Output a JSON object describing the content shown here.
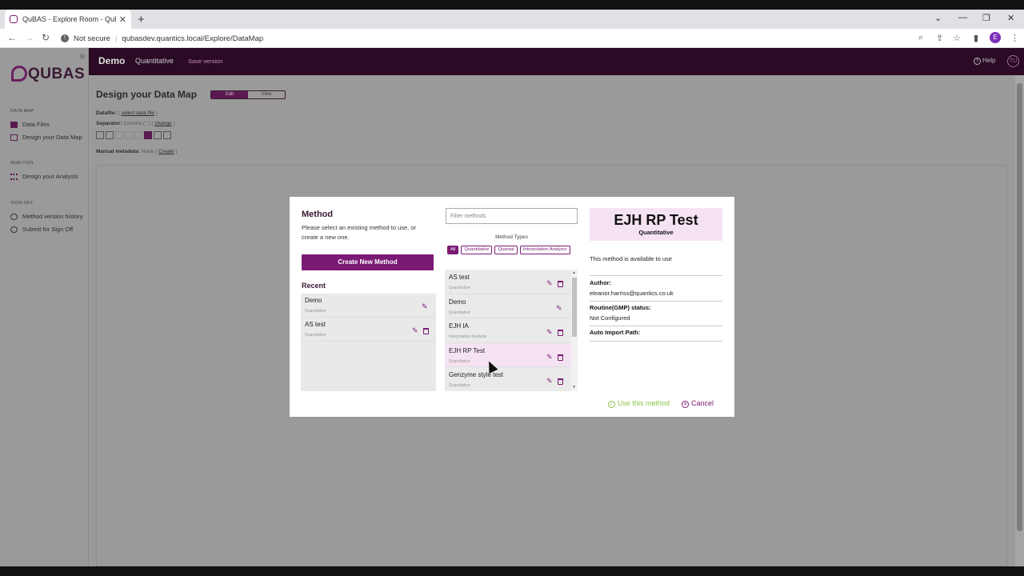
{
  "browser": {
    "tab_title": "QuBAS - Explore Room - QuBAS",
    "not_secure": "Not secure",
    "url": "qubasdev.quantics.local/Explore/DataMap",
    "profile_initial": "E"
  },
  "topbar": {
    "project": "Demo",
    "mode": "Quantitative",
    "save_version": "Save version",
    "help": "Help",
    "user_initials": "TU"
  },
  "sidebar": {
    "logo": "QUBAS",
    "sections": {
      "data_map": "DATA MAP",
      "analysis": "ANALYSIS",
      "sign_off": "SIGN OFF"
    },
    "items": {
      "data_files": "Data Files",
      "design_data_map": "Design your Data Map",
      "design_analysis": "Design your Analysis",
      "method_history": "Method version history",
      "submit_signoff": "Submit for Sign Off"
    }
  },
  "page": {
    "title": "Design your Data Map",
    "toggle_edit": "Edit",
    "toggle_view": "View",
    "datafile_label": "Datafile:",
    "datafile_open": "(",
    "datafile_link": "select data file",
    "datafile_close": ")",
    "separator_label": "Separator:",
    "separator_value": "Comma (',') (",
    "separator_link": "change",
    "separator_close": ")",
    "manual_label": "Manual metadata:",
    "manual_value": "None (",
    "manual_link": "Create",
    "manual_close": ")"
  },
  "modal": {
    "title": "Method",
    "description": "Please select an existing method to use, or create a new one.",
    "create_button": "Create New Method",
    "recent_heading": "Recent",
    "recent": [
      {
        "name": "Demo",
        "type": "Quantitative"
      },
      {
        "name": "AS test",
        "type": "Quantitative"
      }
    ],
    "filter_placeholder": "Filter methods",
    "method_types_label": "Method Types",
    "type_chips": [
      "All",
      "Quantitative",
      "Quantal",
      "Interpolation Analysis"
    ],
    "methods": [
      {
        "name": "AS test",
        "type": "Quantitative"
      },
      {
        "name": "Demo",
        "type": "Quantitative"
      },
      {
        "name": "EJH IA",
        "type": "Interpolation Analysis"
      },
      {
        "name": "EJH RP Test",
        "type": "Quantitative"
      },
      {
        "name": "Genzyme style test",
        "type": "Quantitative"
      }
    ],
    "detail": {
      "name": "EJH RP Test",
      "type": "Quantitative",
      "availability": "This method is available to use",
      "author_label": "Author:",
      "author_value": "eleanor.harriss@quantics.co.uk",
      "routine_label": "Routine(GMP) status:",
      "routine_value": "Not Configured",
      "auto_import_label": "Auto Import Path:"
    },
    "use_button": "Use this method",
    "cancel_button": "Cancel"
  }
}
